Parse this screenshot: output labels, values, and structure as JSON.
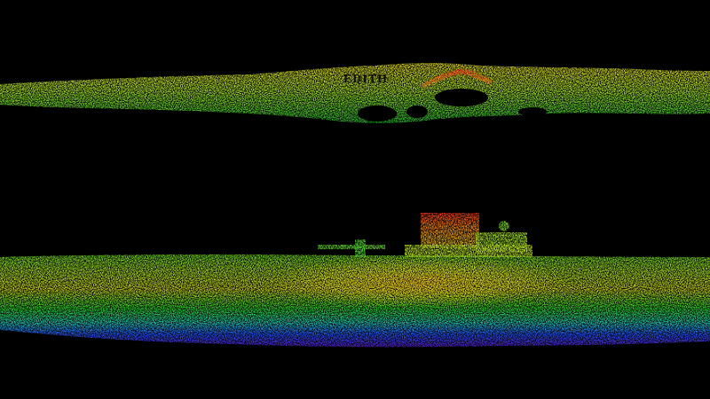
{
  "scene": {
    "description_free": true,
    "background_color": "#000000",
    "palette": {
      "violet": "#5a1fd6",
      "blue": "#2256ff",
      "cyan": "#20c8e0",
      "green": "#2fd12a",
      "yellow_green": "#a6e02a",
      "yellow": "#e8d21c",
      "orange": "#f07a10",
      "red": "#e8241a"
    },
    "upper_band_text": "EDITH"
  }
}
